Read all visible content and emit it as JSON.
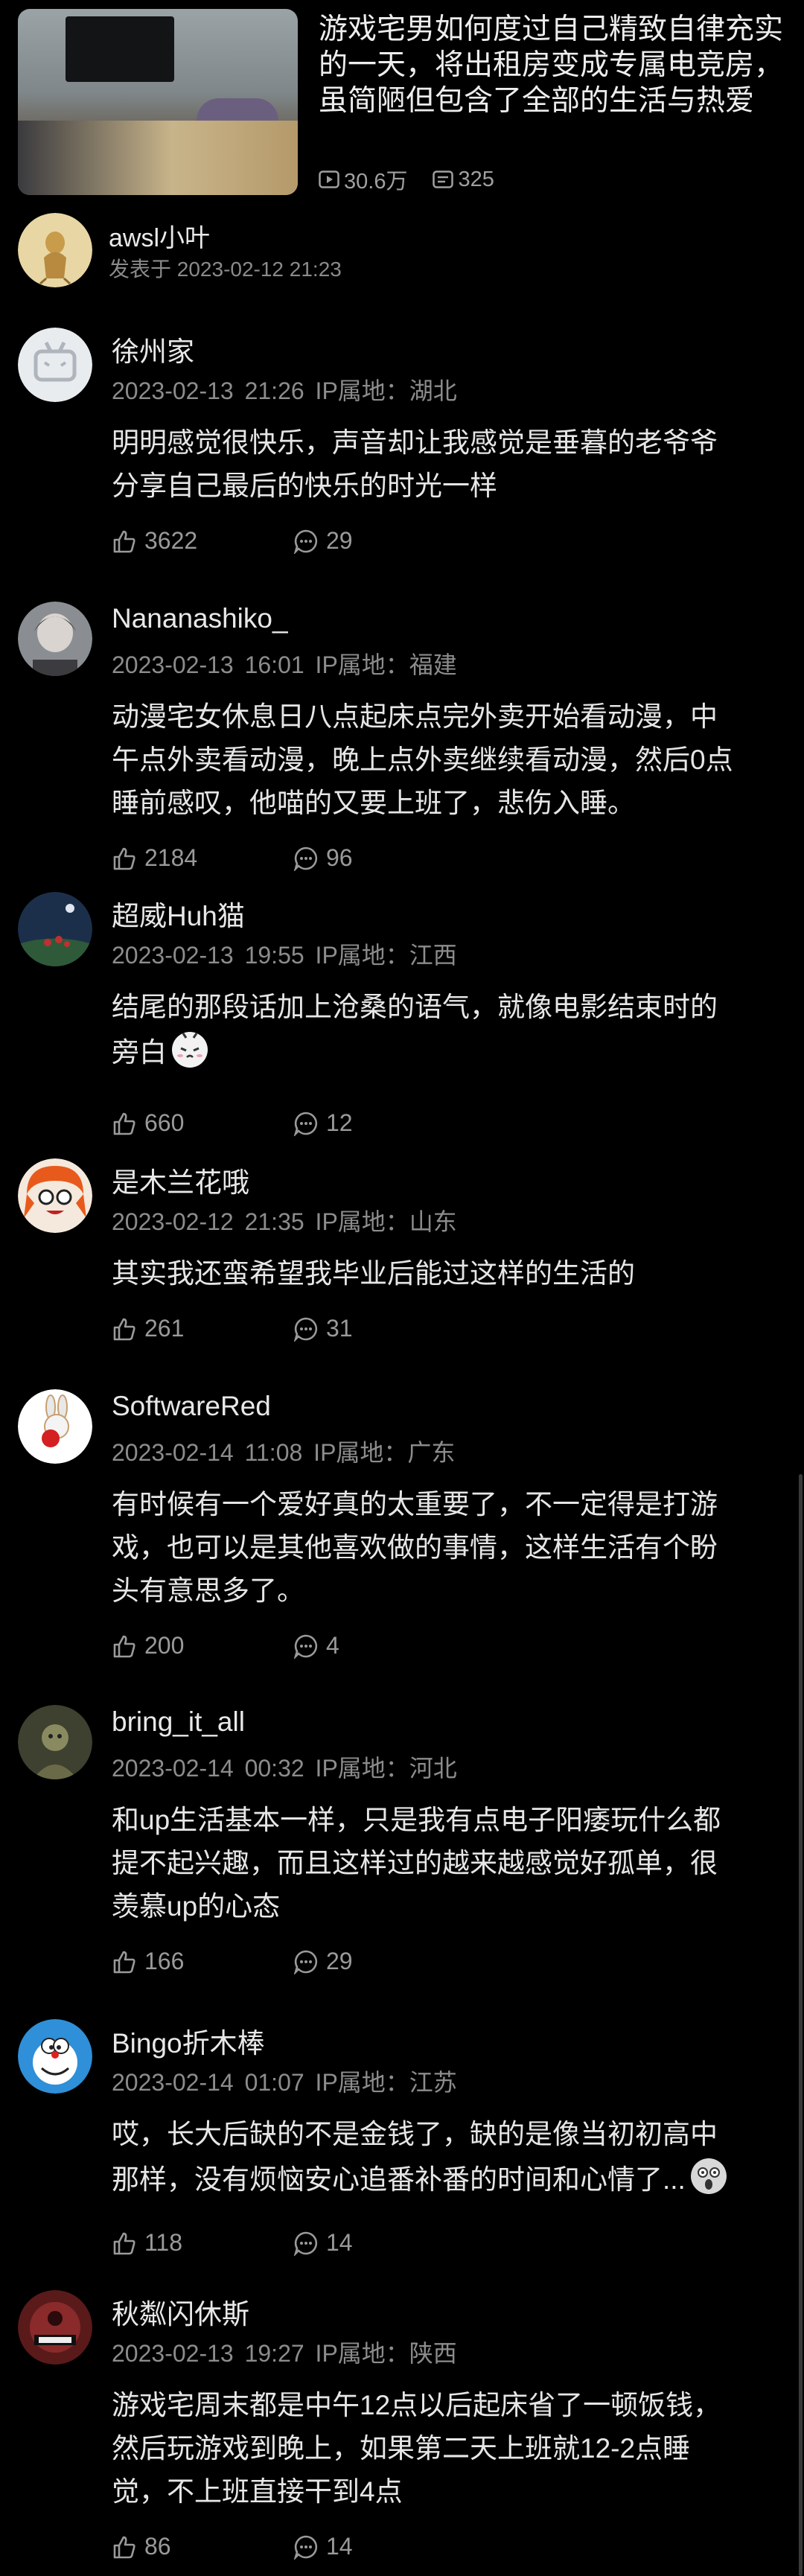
{
  "video": {
    "title": "游戏宅男如何度过自己精致自律充实的一天，将出租房变成专属电竞房，虽简陋但包含了全部的生活与热爱",
    "views": "30.6万",
    "danmaku": "325"
  },
  "uploader": {
    "name": "awsl小叶",
    "date": "发表于 2023-02-12 21:23"
  },
  "comments": [
    {
      "user": "徐州家",
      "meta": "2023-02-13 21:26   IP属地：湖北",
      "lines": [
        "明明感觉很快乐，声音却让我感觉是垂暮的老爷爷",
        "分享自己最后的快乐的时光一样"
      ],
      "likes": "3622",
      "replies": "29"
    },
    {
      "user": "Nananashiko_",
      "meta": "2023-02-13 16:01   IP属地：福建",
      "lines": [
        "动漫宅女休息日八点起床点完外卖开始看动漫，中",
        "午点外卖看动漫，晚上点外卖继续看动漫，然后0点",
        "睡前感叹，他喵的又要上班了，悲伤入睡。"
      ],
      "likes": "2184",
      "replies": "96"
    },
    {
      "user": "超威Huh猫",
      "meta": "2023-02-13 19:55   IP属地：江西",
      "lines": [
        "结尾的那段话加上沧桑的语气，就像电影结束时的",
        "旁白"
      ],
      "likes": "660",
      "replies": "12"
    },
    {
      "user": "是木兰花哦",
      "meta": "2023-02-12 21:35   IP属地：山东",
      "lines": [
        "其实我还蛮希望我毕业后能过这样的生活的"
      ],
      "likes": "261",
      "replies": "31"
    },
    {
      "user": "SoftwareRed",
      "meta": "2023-02-14 11:08   IP属地：广东",
      "lines": [
        "有时候有一个爱好真的太重要了，不一定得是打游",
        "戏，也可以是其他喜欢做的事情，这样生活有个盼",
        "头有意思多了。"
      ],
      "likes": "200",
      "replies": "4"
    },
    {
      "user": "bring_it_all",
      "meta": "2023-02-14 00:32   IP属地：河北",
      "lines": [
        "和up生活基本一样，只是我有点电子阳痿玩什么都",
        "提不起兴趣，而且这样过的越来越感觉好孤单，很",
        "羡慕up的心态"
      ],
      "likes": "166",
      "replies": "29"
    },
    {
      "user": "Bingo折木棒",
      "meta": "2023-02-14 01:07   IP属地：江苏",
      "lines": [
        "哎，长大后缺的不是金钱了，缺的是像当初初高中",
        "那样，没有烦恼安心追番补番的时间和心情了..."
      ],
      "likes": "118",
      "replies": "14"
    },
    {
      "user": "秋粼闪休斯",
      "meta": "2023-02-13 19:27   IP属地：陕西",
      "lines": [
        "游戏宅周末都是中午12点以后起床省了一顿饭钱，",
        "然后玩游戏到晚上，如果第二天上班就12-2点睡",
        "觉，不上班直接干到4点"
      ],
      "likes": "86",
      "replies": "14"
    }
  ]
}
